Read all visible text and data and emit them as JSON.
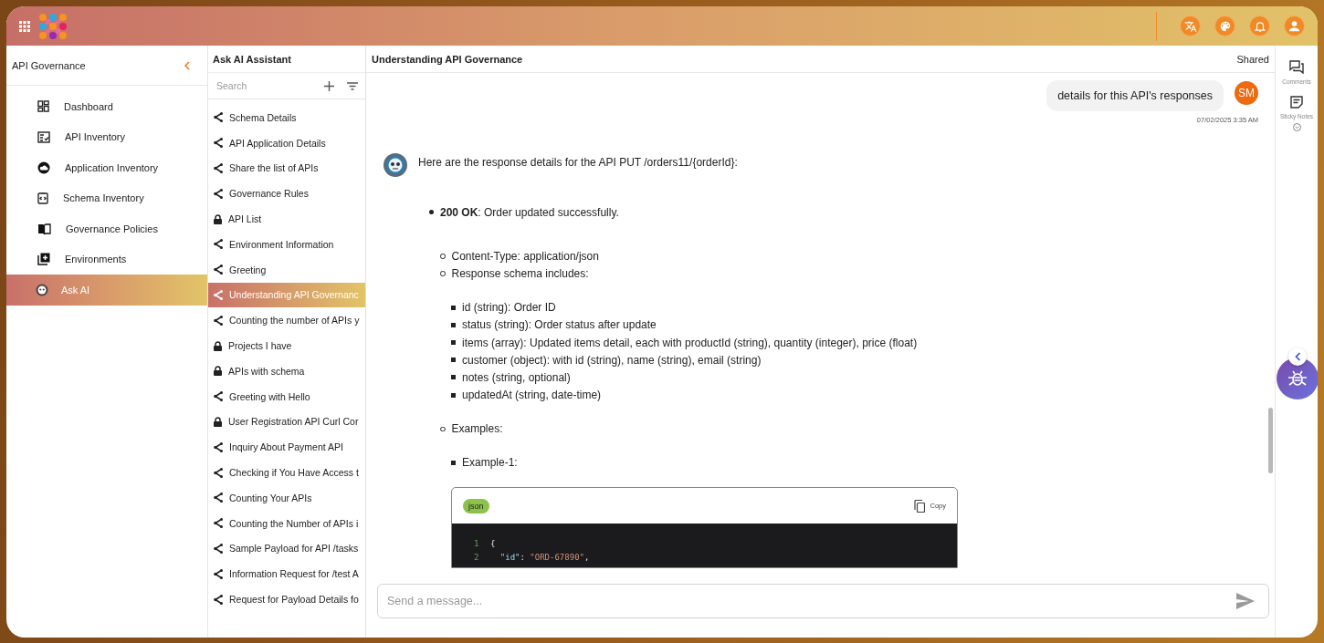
{
  "sidebar": {
    "title": "API Governance",
    "items": [
      {
        "label": "Dashboard",
        "kind": "dashboard",
        "selected": false
      },
      {
        "label": "API Inventory",
        "kind": "checklist",
        "selected": false
      },
      {
        "label": "Application Inventory",
        "kind": "cloud",
        "selected": false
      },
      {
        "label": "Schema Inventory",
        "kind": "code",
        "selected": false
      },
      {
        "label": "Governance Policies",
        "kind": "book",
        "selected": false
      },
      {
        "label": "Environments",
        "kind": "add",
        "selected": false
      },
      {
        "label": "Ask AI",
        "kind": "bot",
        "selected": true
      }
    ]
  },
  "chats": {
    "title": "Ask AI Assistant",
    "search": {
      "placeholder": "Search"
    },
    "items": [
      {
        "label": "Schema Details",
        "kind": "shared",
        "selected": false
      },
      {
        "label": "API Application Details",
        "kind": "shared",
        "selected": false
      },
      {
        "label": "Share the list of APIs",
        "kind": "shared",
        "selected": false
      },
      {
        "label": "Governance Rules",
        "kind": "shared",
        "selected": false
      },
      {
        "label": "API List",
        "kind": "locked",
        "selected": false
      },
      {
        "label": "Environment Information",
        "kind": "shared",
        "selected": false
      },
      {
        "label": "Greeting",
        "kind": "shared",
        "selected": false
      },
      {
        "label": "Understanding API Governanc",
        "kind": "shared",
        "selected": true
      },
      {
        "label": "Counting the number of APIs y",
        "kind": "shared",
        "selected": false
      },
      {
        "label": "Projects I have",
        "kind": "locked",
        "selected": false
      },
      {
        "label": "APIs with schema",
        "kind": "locked",
        "selected": false
      },
      {
        "label": "Greeting with Hello",
        "kind": "shared",
        "selected": false
      },
      {
        "label": "User Registration API Curl Cor",
        "kind": "locked",
        "selected": false
      },
      {
        "label": "Inquiry About Payment API",
        "kind": "shared",
        "selected": false
      },
      {
        "label": "Checking if You Have Access t",
        "kind": "shared",
        "selected": false
      },
      {
        "label": "Counting Your APIs",
        "kind": "shared",
        "selected": false
      },
      {
        "label": "Counting the Number of APIs i",
        "kind": "shared",
        "selected": false
      },
      {
        "label": "Sample Payload for API /tasks",
        "kind": "shared",
        "selected": false
      },
      {
        "label": "Information Request for /test A",
        "kind": "shared",
        "selected": false
      },
      {
        "label": "Request for Payload Details fo",
        "kind": "shared",
        "selected": false
      }
    ]
  },
  "conversation": {
    "title": "Understanding API Governance",
    "status": "Shared",
    "user_message": {
      "avatar": "SM",
      "text": "details for this API's responses",
      "time": "07/02/2025 3:35 AM"
    },
    "reply": {
      "intro": "Here are the response details for the API PUT /orders11/{orderId}:",
      "items": [
        {
          "text": "**200 OK**: Order updated successfully.",
          "children": [
            {
              "text": "Content-Type: application/json"
            },
            {
              "text": "Response schema includes:",
              "children": [
                {
                  "text": "id (string): Order ID"
                },
                {
                  "text": "status (string): Order status after update"
                },
                {
                  "text": "items (array): Updated items detail, each with productId (string), quantity (integer), price (float)"
                },
                {
                  "text": "customer (object): with id (string), name (string), email (string)"
                },
                {
                  "text": "notes (string, optional)"
                },
                {
                  "text": "updatedAt (string, date-time)"
                }
              ]
            },
            {
              "text": "Examples:",
              "children": [
                {
                  "text": "Example-1:",
                  "code": {
                    "language": "json",
                    "copy_label": "Copy",
                    "lines": [
                      {
                        "number": "1",
                        "tokens": [
                          {
                            "kind": "punct",
                            "text": "{"
                          }
                        ]
                      },
                      {
                        "number": "2",
                        "tokens": [
                          {
                            "kind": "key",
                            "text": "  \"id\""
                          },
                          {
                            "kind": "punct",
                            "text": ": "
                          },
                          {
                            "kind": "string",
                            "text": "\"ORD-67890\""
                          },
                          {
                            "kind": "punct",
                            "text": ","
                          }
                        ]
                      }
                    ]
                  }
                }
              ]
            }
          ]
        }
      ]
    }
  },
  "composer": {
    "placeholder": "Send a message..."
  },
  "rail": {
    "items": [
      {
        "label": "Comments",
        "kind": "comments"
      },
      {
        "label": "Sticky Notes",
        "kind": "notes"
      }
    ]
  }
}
